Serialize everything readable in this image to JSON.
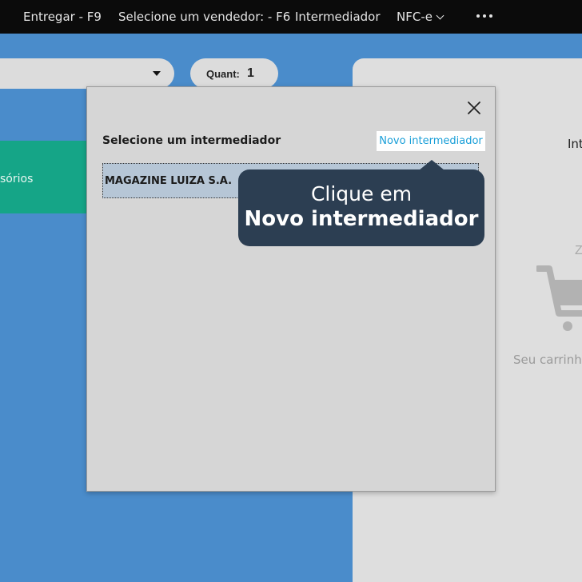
{
  "topbar": {
    "deliver": "Entregar - F9",
    "select_seller": "Selecione um vendedor: - F6",
    "intermediary": "Intermediador",
    "nfce": "NFC-e",
    "more_icon": "more-dots-icon"
  },
  "sale": {
    "quant_label": "Quant:",
    "quant_value": "1",
    "category_label": "sórios"
  },
  "cart": {
    "title": "Int",
    "zz": "Z",
    "empty_text": "Seu carrinho",
    "cart_icon": "cart-icon"
  },
  "modal": {
    "heading": "Selecione um intermediador",
    "new_button": "Novo intermediador",
    "items": [
      {
        "name": "MAGAZINE LUIZA S.A."
      }
    ],
    "close_icon": "close-icon"
  },
  "tooltip": {
    "line1": "Clique em",
    "line2": "Novo intermediador"
  },
  "colors": {
    "topbar": "#0b0b0b",
    "background": "#4a8ccb",
    "modal_bg": "#d6d6d6",
    "link": "#1a9fd8",
    "tooltip_bg": "#2c3e52",
    "category_tile": "#15a587",
    "selected_row": "#b6c6d6"
  }
}
